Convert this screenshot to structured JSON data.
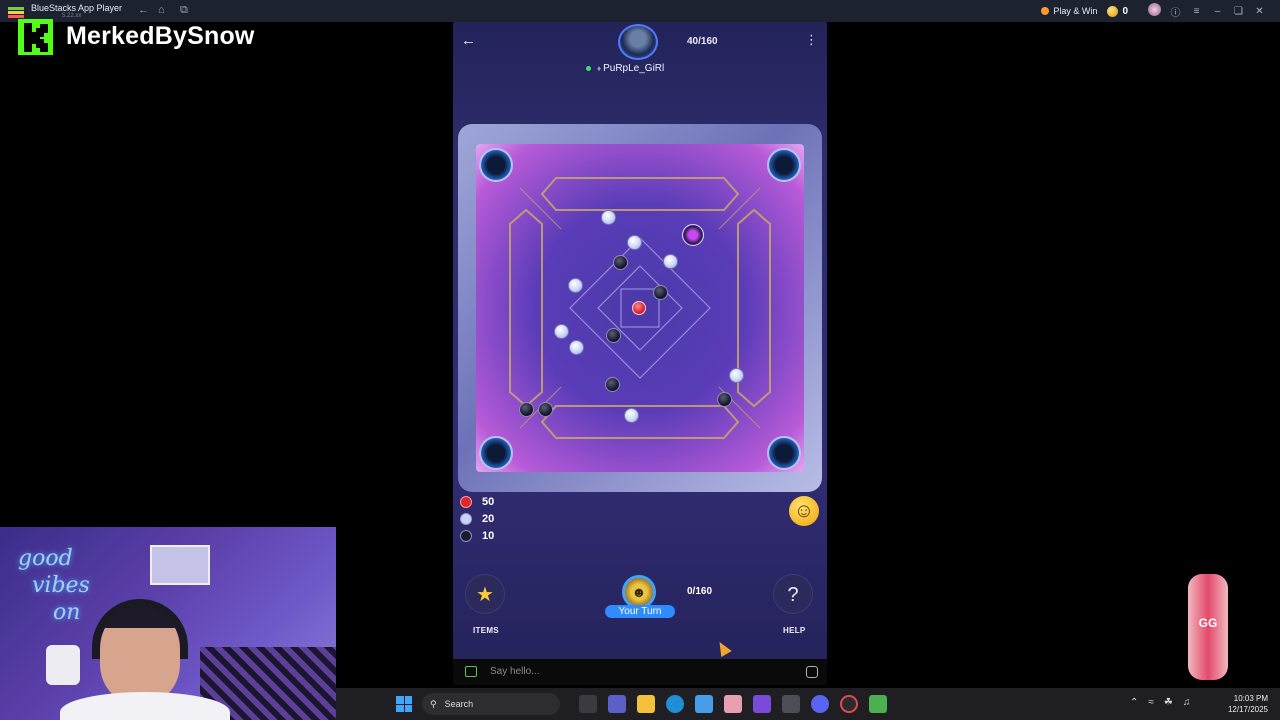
{
  "titlebar": {
    "app_title": "BlueStacks App Player",
    "subtitle": "5.22.xx",
    "play_win_label": "Play & Win",
    "coin_count": "0"
  },
  "overlay": {
    "streamer_name": "MerkedBySnow"
  },
  "game": {
    "opponent": {
      "name": "PuRpLe_GiRl",
      "tag": "♦",
      "score": "40/160"
    },
    "scoreboard": [
      {
        "coin": "queen",
        "color": "#e0262f",
        "points": "50"
      },
      {
        "coin": "white",
        "color": "#c9d3f7",
        "points": "20"
      },
      {
        "coin": "black",
        "color": "#1a1b30",
        "points": "10"
      }
    ],
    "player": {
      "turn_label": "Your Turn",
      "score": "0/160"
    },
    "buttons": {
      "items_label": "ITEMS",
      "help_label": "HELP",
      "help_glyph": "?",
      "items_glyph": "★",
      "emoji_glyph": "☺"
    }
  },
  "chat": {
    "placeholder": "Say hello..."
  },
  "webcam": {
    "neon_sign": "good vibes only"
  },
  "badge": {
    "label": "GG"
  },
  "taskbar": {
    "search_label": "Search",
    "time": "10:03 PM",
    "date": "12/17/2025"
  }
}
